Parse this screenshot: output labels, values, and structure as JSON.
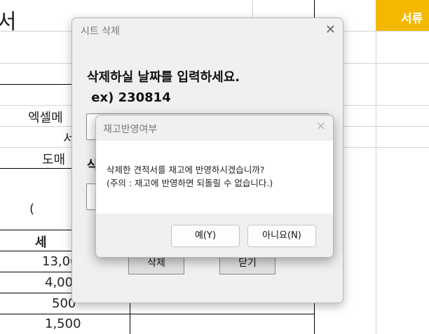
{
  "sheet": {
    "top_left_char": "서",
    "label_excel": "엑셀메",
    "label_seo": "서",
    "label_domae": "도매",
    "paren": "(",
    "header_se": "세",
    "values": [
      "13,00",
      "4,00",
      "500",
      "1,500"
    ],
    "badge": "서류"
  },
  "dialog": {
    "title": "시트 삭제",
    "close_glyph": "✕",
    "message": "삭제하실 날짜를 입력하세요.\n ex) 230814",
    "label2": "삭",
    "input1_value": "",
    "input2_value": "",
    "delete_label": "삭제",
    "close_label": "닫기"
  },
  "modal": {
    "title": "재고반영여부",
    "close_glyph": "✕",
    "text": "삭제한 견적서를 재고에 반영하시겠습니까?\n(주의 : 재고에 반영하면 되돌릴 수 없습니다.)",
    "yes_label": "예(Y)",
    "no_label": "아니요(N)"
  },
  "colors": {
    "accent": "#f5b800",
    "dialog_bg": "#f0f0f0"
  }
}
